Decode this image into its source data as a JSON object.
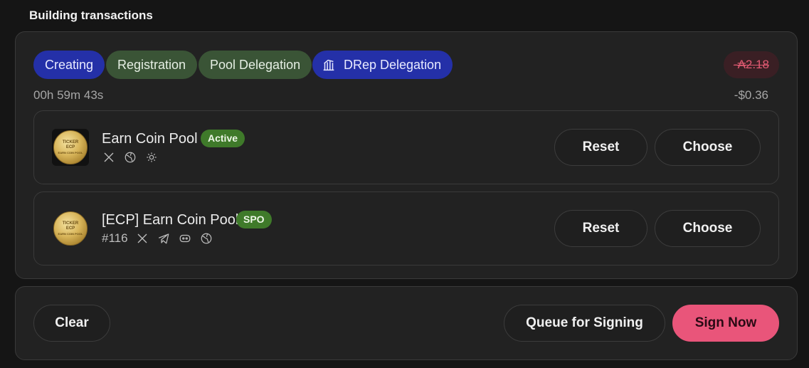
{
  "heading": "Building transactions",
  "steps": [
    {
      "label": "Creating",
      "state": "active"
    },
    {
      "label": "Registration",
      "state": "done"
    },
    {
      "label": "Pool Delegation",
      "state": "done"
    },
    {
      "label": "DRep Delegation",
      "state": "active",
      "icon": "bank-icon"
    }
  ],
  "fee": {
    "ada": "-₳2.18",
    "usd": "-$0.36"
  },
  "timer": "00h 59m 43s",
  "cards": [
    {
      "name": "Earn Coin Pool",
      "badge": "Active",
      "coin_text": [
        "TICKER",
        "ECP",
        "EARN COIN POOL"
      ],
      "icons": [
        "x-icon",
        "globe-icon",
        "sun-icon"
      ],
      "reset_label": "Reset",
      "choose_label": "Choose"
    },
    {
      "name": "[ECP] Earn Coin Pool",
      "badge": "SPO",
      "rank": "#116",
      "coin_text": [
        "TICKER",
        "ECP",
        "EARN COIN POOL"
      ],
      "icons": [
        "x-icon",
        "telegram-icon",
        "discord-icon",
        "globe-icon"
      ],
      "reset_label": "Reset",
      "choose_label": "Choose"
    }
  ],
  "footer": {
    "clear_label": "Clear",
    "queue_label": "Queue for Signing",
    "sign_label": "Sign Now"
  },
  "colors": {
    "active_step": "#2430a8",
    "done_step": "#3a5436",
    "badge_green": "#3f7a2a",
    "sign_button": "#e9557a",
    "fee_text": "#e05a72"
  }
}
